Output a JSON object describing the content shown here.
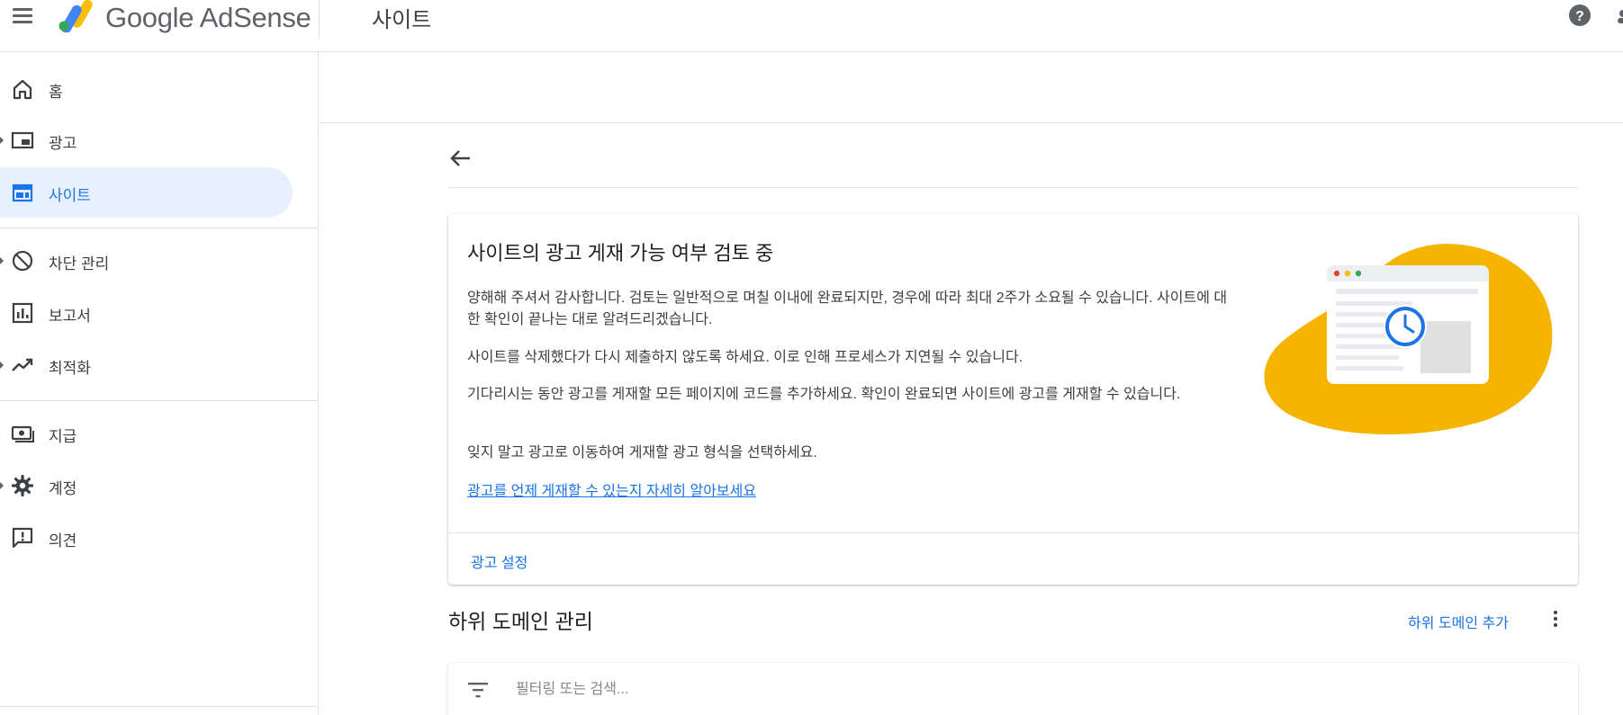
{
  "header": {
    "brand": "Google AdSense",
    "page_title": "사이트",
    "help_icon": "help-circle-icon"
  },
  "colors": {
    "accent": "#1a73e8",
    "active_bg": "#e8f0fe",
    "illustration_blob": "#f4b400"
  },
  "sidebar": {
    "items": [
      {
        "label": "홈",
        "icon": "home-icon"
      },
      {
        "label": "광고",
        "icon": "ads-icon"
      },
      {
        "label": "사이트",
        "icon": "sites-icon",
        "active": true
      },
      {
        "label": "차단 관리",
        "icon": "block-icon"
      },
      {
        "label": "보고서",
        "icon": "reports-icon"
      },
      {
        "label": "최적화",
        "icon": "trending-up-icon"
      },
      {
        "label": "지급",
        "icon": "payments-icon"
      },
      {
        "label": "계정",
        "icon": "gear-icon"
      },
      {
        "label": "의견",
        "icon": "feedback-icon"
      }
    ]
  },
  "review_card": {
    "title": "사이트의 광고 게재 가능 여부 검토 중",
    "paragraphs": [
      "양해해 주셔서 감사합니다. 검토는 일반적으로 며칠 이내에 완료되지만, 경우에 따라 최대 2주가 소요될 수 있습니다. 사이트에 대한 확인이 끝나는 대로 알려드리겠습니다.",
      "사이트를 삭제했다가 다시 제출하지 않도록 하세요. 이로 인해 프로세스가 지연될 수 있습니다.",
      "기다리시는 동안 광고를 게재할 모든 페이지에 코드를 추가하세요. 확인이 완료되면 사이트에 광고를 게재할 수 있습니다.",
      "잊지 말고 광고로 이동하여 게재할 광고 형식을 선택하세요."
    ],
    "link": "광고를 언제 게재할 수 있는지 자세히 알아보세요",
    "action": "광고 설정"
  },
  "subdomains": {
    "title": "하위 도메인 관리",
    "add_label": "하위 도메인 추가",
    "filter_placeholder": "필터링 또는 검색..."
  }
}
